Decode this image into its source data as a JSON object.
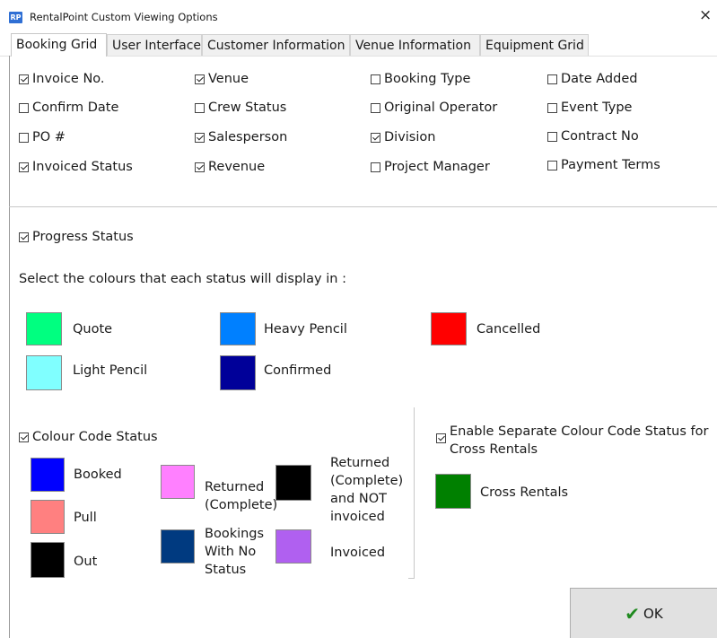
{
  "window": {
    "app_icon_text": "RP",
    "title": "RentalPoint Custom Viewing Options",
    "close_glyph": "×"
  },
  "tabs": [
    {
      "label": "Booking Grid",
      "active": true
    },
    {
      "label": "User Interface",
      "active": false
    },
    {
      "label": "Customer Information",
      "active": false
    },
    {
      "label": "Venue Information",
      "active": false
    },
    {
      "label": "Equipment Grid",
      "active": false
    }
  ],
  "fields": [
    {
      "label": "Invoice No.",
      "checked": true
    },
    {
      "label": "Venue",
      "checked": true
    },
    {
      "label": "Booking Type",
      "checked": false
    },
    {
      "label": "Date Added",
      "checked": false
    },
    {
      "label": "Confirm Date",
      "checked": false
    },
    {
      "label": "Crew Status",
      "checked": false
    },
    {
      "label": "Original Operator",
      "checked": false
    },
    {
      "label": "Event Type",
      "checked": false
    },
    {
      "label": "PO #",
      "checked": false
    },
    {
      "label": "Salesperson",
      "checked": true
    },
    {
      "label": "Division",
      "checked": true
    },
    {
      "label": "Contract No",
      "checked": false
    },
    {
      "label": "Invoiced Status",
      "checked": true
    },
    {
      "label": "Revenue",
      "checked": true
    },
    {
      "label": "Project Manager",
      "checked": false
    },
    {
      "label": "Payment Terms",
      "checked": false
    }
  ],
  "progress": {
    "label": "Progress Status",
    "checked": true,
    "instruction": "Select the colours that each status will display in :",
    "statuses": [
      {
        "label": "Quote",
        "color": "#00ff80"
      },
      {
        "label": "Heavy Pencil",
        "color": "#0080ff"
      },
      {
        "label": "Cancelled",
        "color": "#ff0000"
      },
      {
        "label": "Light Pencil",
        "color": "#80ffff"
      },
      {
        "label": "Confirmed",
        "color": "#000099"
      }
    ]
  },
  "colour_code": {
    "label": "Colour Code Status",
    "checked": true,
    "statuses": [
      {
        "label": "Booked",
        "color": "#0000ff"
      },
      {
        "label": "Pull",
        "color": "#ff8080"
      },
      {
        "label": "Out",
        "color": "#000000"
      },
      {
        "label": "Returned (Complete)",
        "color": "#ff80ff"
      },
      {
        "label": "Bookings With No Status",
        "color": "#003a80"
      },
      {
        "label": "Returned (Complete) and NOT invoiced",
        "color": "#000000"
      },
      {
        "label": "Invoiced",
        "color": "#b060f0"
      }
    ]
  },
  "cross_rentals": {
    "label": "Enable Separate Colour Code Status for Cross Rentals",
    "checked": true,
    "status": {
      "label": "Cross Rentals",
      "color": "#008000"
    }
  },
  "footer": {
    "ok_icon": "✔",
    "ok_label": "OK"
  }
}
